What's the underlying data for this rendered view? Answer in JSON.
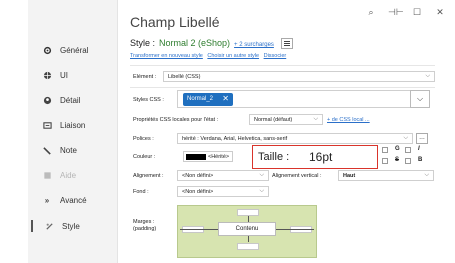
{
  "window": {
    "title": "Champ Libellé",
    "controls": [
      "⌕",
      "⊣⊢",
      "☐",
      "✕"
    ]
  },
  "sidebar": {
    "items": [
      {
        "label": "Général",
        "icon": "gear-icon",
        "glyph": "✱",
        "disabled": false
      },
      {
        "label": "UI",
        "icon": "globe-icon",
        "glyph": "◉",
        "disabled": false
      },
      {
        "label": "Détail",
        "icon": "detail-icon",
        "glyph": "◉",
        "disabled": false
      },
      {
        "label": "Liaison",
        "icon": "link-icon",
        "glyph": "⇄",
        "disabled": false
      },
      {
        "label": "Note",
        "icon": "pencil-icon",
        "glyph": "✎",
        "disabled": false
      },
      {
        "label": "Aide",
        "icon": "help-icon",
        "glyph": "▦",
        "disabled": true
      },
      {
        "label": "Avancé",
        "icon": "advanced-icon",
        "glyph": "»",
        "disabled": false
      },
      {
        "label": "Style",
        "icon": "palette-icon",
        "glyph": "✿",
        "disabled": false,
        "active": true
      }
    ]
  },
  "style": {
    "label": "Style :",
    "value": "Normal 2 (eShop)",
    "surcharges": "+ 2 surcharges",
    "links": [
      "Transformer en nouveau style",
      "Choisir un autre style",
      "Dissocier"
    ]
  },
  "form": {
    "element_label": "Elément :",
    "element_value": "Libellé (CSS)",
    "styles_css_label": "Styles CSS :",
    "styles_css_tag": "Normal_2",
    "props_label": "Propriétés CSS locales pour l'état :",
    "props_value": "Normal (défaut)",
    "css_local_link": "+ de CSS local ...",
    "polices_label": "Polices :",
    "polices_value": "hérité : Verdana, Arial, Helvetica, sans-serif",
    "couleur_label": "Couleur :",
    "couleur_value": "<Hérité>",
    "taille_label": "Taille :",
    "taille_value": "16pt",
    "checks": [
      "G",
      "I",
      "S",
      "B"
    ],
    "alignement_label": "Alignement :",
    "alignement_value": "<Non défini>",
    "alignement_v_label": "Alignement vertical :",
    "alignement_v_value": "Haut",
    "fond_label": "Fond :",
    "fond_value": "<Non défini>",
    "marges_label": "Marges :",
    "marges_sub": "(padding)",
    "contenu_label": "Contenu",
    "colors": {
      "tag": "#1f6fbf",
      "highlight": "#d9342b",
      "margin_bg": "#d7e4b0",
      "style_value": "#2e7d2e"
    }
  }
}
